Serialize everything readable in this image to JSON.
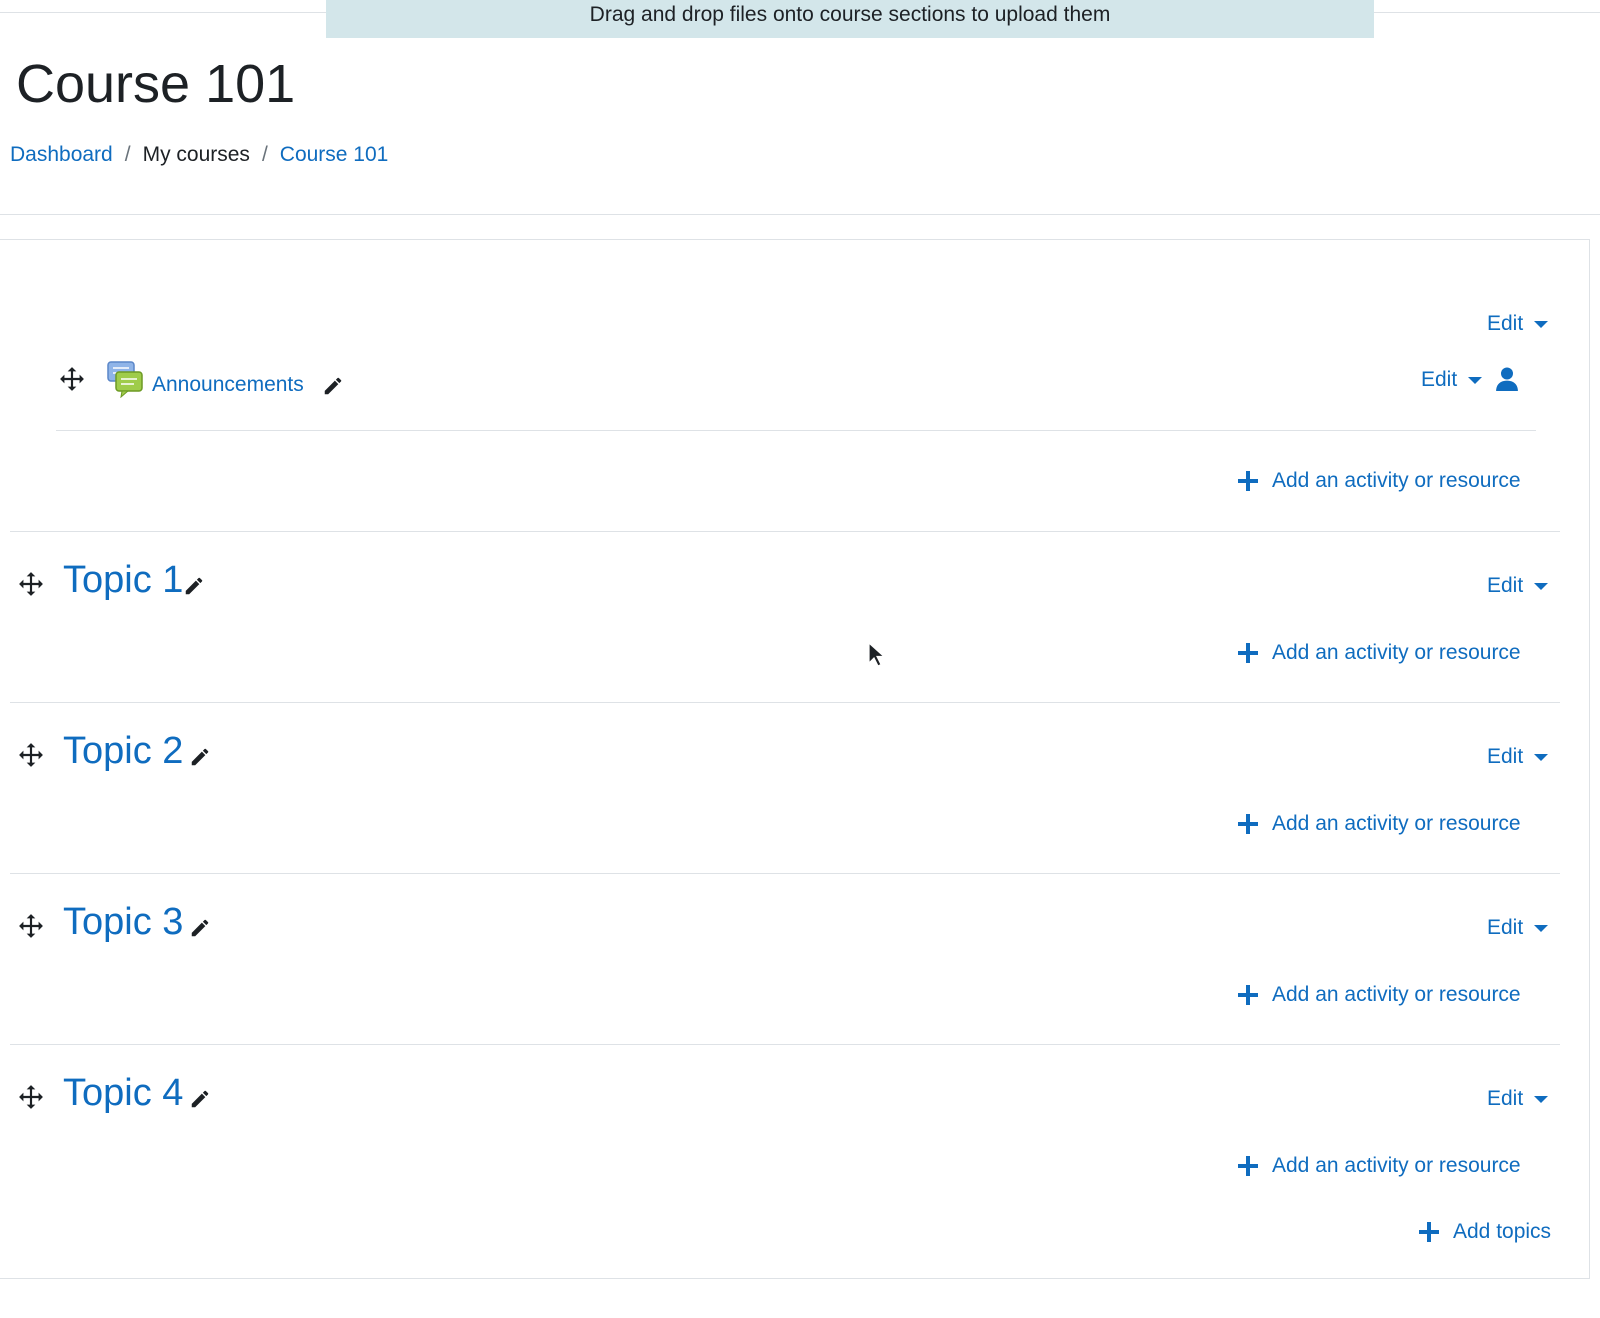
{
  "banner": {
    "text": "Drag and drop files onto course sections to upload them"
  },
  "page": {
    "title": "Course 101"
  },
  "breadcrumb": {
    "items": [
      {
        "label": "Dashboard",
        "link": true
      },
      {
        "label": "My courses",
        "link": false
      },
      {
        "label": "Course 101",
        "link": true
      }
    ],
    "separator": "/"
  },
  "general_section": {
    "edit_label": "Edit",
    "activity": {
      "name": "Announcements",
      "icon": "forum-icon",
      "edit_label": "Edit"
    },
    "add_label": "Add an activity or resource"
  },
  "topics": [
    {
      "title": "Topic 1",
      "edit_label": "Edit",
      "add_label": "Add an activity or resource"
    },
    {
      "title": "Topic 2",
      "edit_label": "Edit",
      "add_label": "Add an activity or resource"
    },
    {
      "title": "Topic 3",
      "edit_label": "Edit",
      "add_label": "Add an activity or resource"
    },
    {
      "title": "Topic 4",
      "edit_label": "Edit",
      "add_label": "Add an activity or resource"
    }
  ],
  "footer": {
    "add_topics_label": "Add topics"
  },
  "colors": {
    "link": "#0f6cbf",
    "banner_bg": "#d3e6ea",
    "text": "#1d2125",
    "border": "#dee2e6"
  }
}
